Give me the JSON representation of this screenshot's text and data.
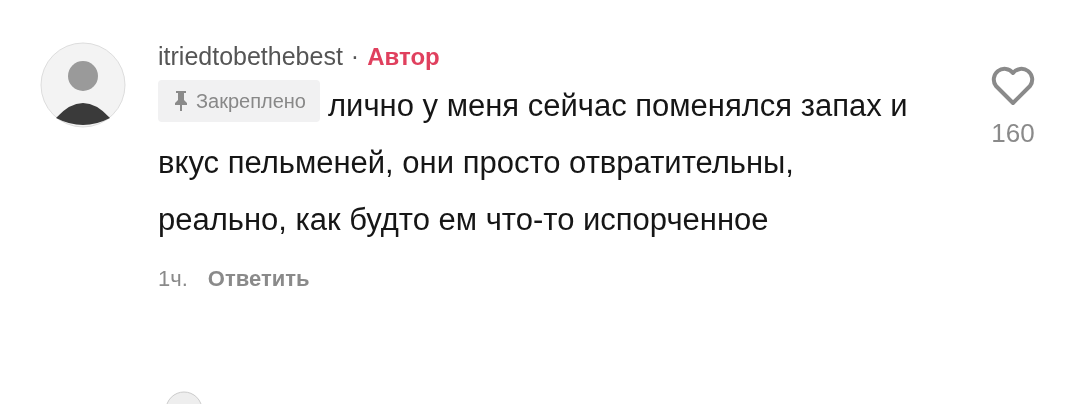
{
  "comment": {
    "username": "itriedtobethebest",
    "separator": "·",
    "author_badge": "Автор",
    "pinned": true,
    "pinned_label": "Закреплено",
    "text": "лично у меня сейчас поменялся запах и вкус пельменей, они просто отвратительны, реально, как будто ем что-то испорченное",
    "time": "1ч.",
    "reply": "Ответить",
    "liked": false,
    "likes": "160"
  }
}
